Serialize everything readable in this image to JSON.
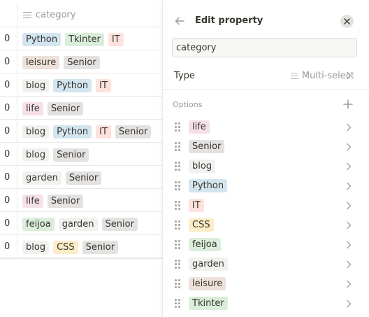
{
  "table": {
    "column_header": "category",
    "rows": [
      {
        "num": "0",
        "tags": [
          {
            "label": "Python",
            "color": "#d3e5ef"
          },
          {
            "label": "Tkinter",
            "color": "#dbeddb"
          },
          {
            "label": "IT",
            "color": "#ffe2dd"
          }
        ]
      },
      {
        "num": "0",
        "tags": [
          {
            "label": "leisure",
            "color": "#eee0da"
          },
          {
            "label": "Senior",
            "color": "#e3e2e0"
          }
        ]
      },
      {
        "num": "0",
        "tags": [
          {
            "label": "blog",
            "color": "#f1f1ef"
          },
          {
            "label": "Python",
            "color": "#d3e5ef"
          },
          {
            "label": "IT",
            "color": "#ffe2dd"
          }
        ]
      },
      {
        "num": "0",
        "tags": [
          {
            "label": "life",
            "color": "#f5e0e9"
          },
          {
            "label": "Senior",
            "color": "#e3e2e0"
          }
        ]
      },
      {
        "num": "0",
        "tags": [
          {
            "label": "blog",
            "color": "#f1f1ef"
          },
          {
            "label": "Python",
            "color": "#d3e5ef"
          },
          {
            "label": "IT",
            "color": "#ffe2dd"
          },
          {
            "label": "Senior",
            "color": "#e3e2e0"
          }
        ]
      },
      {
        "num": "0",
        "tags": [
          {
            "label": "blog",
            "color": "#f1f1ef"
          },
          {
            "label": "Senior",
            "color": "#e3e2e0"
          }
        ]
      },
      {
        "num": "0",
        "tags": [
          {
            "label": "garden",
            "color": "#f1f1ef"
          },
          {
            "label": "Senior",
            "color": "#e3e2e0"
          }
        ]
      },
      {
        "num": "0",
        "tags": [
          {
            "label": "life",
            "color": "#f5e0e9"
          },
          {
            "label": "Senior",
            "color": "#e3e2e0"
          }
        ]
      },
      {
        "num": "0",
        "tags": [
          {
            "label": "feijoa",
            "color": "#dbeddb"
          },
          {
            "label": "garden",
            "color": "#f1f1ef"
          },
          {
            "label": "Senior",
            "color": "#e3e2e0"
          }
        ]
      },
      {
        "num": "0",
        "tags": [
          {
            "label": "blog",
            "color": "#f1f1ef"
          },
          {
            "label": "CSS",
            "color": "#fdecc8"
          },
          {
            "label": "Senior",
            "color": "#e3e2e0"
          }
        ]
      }
    ]
  },
  "panel": {
    "title": "Edit property",
    "name_value": "category",
    "type_label": "Type",
    "type_value": "Multi-select",
    "options_header": "Options",
    "options": [
      {
        "label": "life",
        "color": "#f5e0e9"
      },
      {
        "label": "Senior",
        "color": "#e3e2e0"
      },
      {
        "label": "blog",
        "color": "#f1f1ef"
      },
      {
        "label": "Python",
        "color": "#d3e5ef"
      },
      {
        "label": "IT",
        "color": "#ffe2dd"
      },
      {
        "label": "CSS",
        "color": "#fdecc8"
      },
      {
        "label": "feijoa",
        "color": "#dbeddb"
      },
      {
        "label": "garden",
        "color": "#f1f1ef"
      },
      {
        "label": "leisure",
        "color": "#eee0da"
      },
      {
        "label": "Tkinter",
        "color": "#dbeddb"
      }
    ]
  },
  "icons": {
    "back": "arrow-left-icon",
    "close": "close-icon",
    "list": "list-icon",
    "add": "plus-icon",
    "drag": "drag-handle-icon",
    "chevron": "chevron-right-icon"
  }
}
